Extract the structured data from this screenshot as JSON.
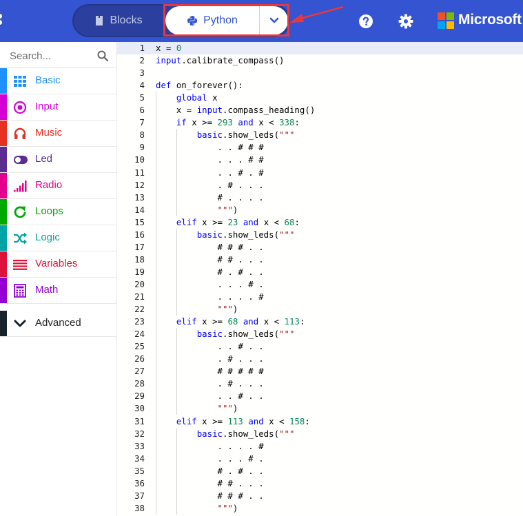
{
  "header": {
    "blocks_label": "Blocks",
    "python_label": "Python",
    "brand": "Microsoft",
    "icons": [
      "menu-dots-icon",
      "blocks-icon",
      "python-icon",
      "chevron-down-icon",
      "help-icon",
      "gear-icon",
      "microsoft-logo"
    ],
    "colors": {
      "bar": "#3454d1",
      "toggle": "#2a3f9e",
      "highlight": "#e8383d"
    }
  },
  "toolbox": {
    "search_placeholder": "Search...",
    "categories": [
      {
        "label": "Basic",
        "color": "#1e90ff",
        "icon": "grid-icon"
      },
      {
        "label": "Input",
        "color": "#d400d4",
        "icon": "target-icon"
      },
      {
        "label": "Music",
        "color": "#e63022",
        "icon": "headphones-icon"
      },
      {
        "label": "Led",
        "color": "#5c2d91",
        "icon": "toggle-icon"
      },
      {
        "label": "Radio",
        "color": "#e3008c",
        "icon": "signal-icon"
      },
      {
        "label": "Loops",
        "color": "#00aa00",
        "icon": "loop-icon"
      },
      {
        "label": "Logic",
        "color": "#00a4a6",
        "icon": "shuffle-icon"
      },
      {
        "label": "Variables",
        "color": "#dc143c",
        "icon": "lines-icon"
      },
      {
        "label": "Math",
        "color": "#9400d3",
        "icon": "calculator-icon"
      }
    ],
    "advanced_label": "Advanced"
  },
  "editor": {
    "lines": [
      {
        "n": "1",
        "t": "x = 0"
      },
      {
        "n": "2",
        "t": "input.calibrate_compass()"
      },
      {
        "n": "3",
        "t": ""
      },
      {
        "n": "4",
        "t": "def on_forever():"
      },
      {
        "n": "5",
        "t": "    global x"
      },
      {
        "n": "6",
        "t": "    x = input.compass_heading()"
      },
      {
        "n": "7",
        "t": "    if x >= 293 and x < 338:"
      },
      {
        "n": "8",
        "t": "        basic.show_leds(\"\"\""
      },
      {
        "n": "9",
        "t": "            . . # # #"
      },
      {
        "n": "10",
        "t": "            . . . # #"
      },
      {
        "n": "11",
        "t": "            . . # . #"
      },
      {
        "n": "12",
        "t": "            . # . . ."
      },
      {
        "n": "13",
        "t": "            # . . . ."
      },
      {
        "n": "14",
        "t": "            \"\"\")"
      },
      {
        "n": "15",
        "t": "    elif x >= 23 and x < 68:"
      },
      {
        "n": "16",
        "t": "        basic.show_leds(\"\"\""
      },
      {
        "n": "17",
        "t": "            # # # . ."
      },
      {
        "n": "18",
        "t": "            # # . . ."
      },
      {
        "n": "19",
        "t": "            # . # . ."
      },
      {
        "n": "20",
        "t": "            . . . # ."
      },
      {
        "n": "21",
        "t": "            . . . . #"
      },
      {
        "n": "22",
        "t": "            \"\"\")"
      },
      {
        "n": "23",
        "t": "    elif x >= 68 and x < 113:"
      },
      {
        "n": "24",
        "t": "        basic.show_leds(\"\"\""
      },
      {
        "n": "25",
        "t": "            . . # . ."
      },
      {
        "n": "26",
        "t": "            . # . . ."
      },
      {
        "n": "27",
        "t": "            # # # # #"
      },
      {
        "n": "28",
        "t": "            . # . . ."
      },
      {
        "n": "29",
        "t": "            . . # . ."
      },
      {
        "n": "30",
        "t": "            \"\"\")"
      },
      {
        "n": "31",
        "t": "    elif x >= 113 and x < 158:"
      },
      {
        "n": "32",
        "t": "        basic.show_leds(\"\"\""
      },
      {
        "n": "33",
        "t": "            . . . . #"
      },
      {
        "n": "34",
        "t": "            . . . # ."
      },
      {
        "n": "35",
        "t": "            # . # . ."
      },
      {
        "n": "36",
        "t": "            # # . . ."
      },
      {
        "n": "37",
        "t": "            # # # . ."
      },
      {
        "n": "38",
        "t": "            \"\"\")"
      }
    ],
    "colors": {
      "keyword": "#0000ff",
      "number": "#098658",
      "string": "#a31515",
      "current_line": "#e8ecf8"
    }
  }
}
